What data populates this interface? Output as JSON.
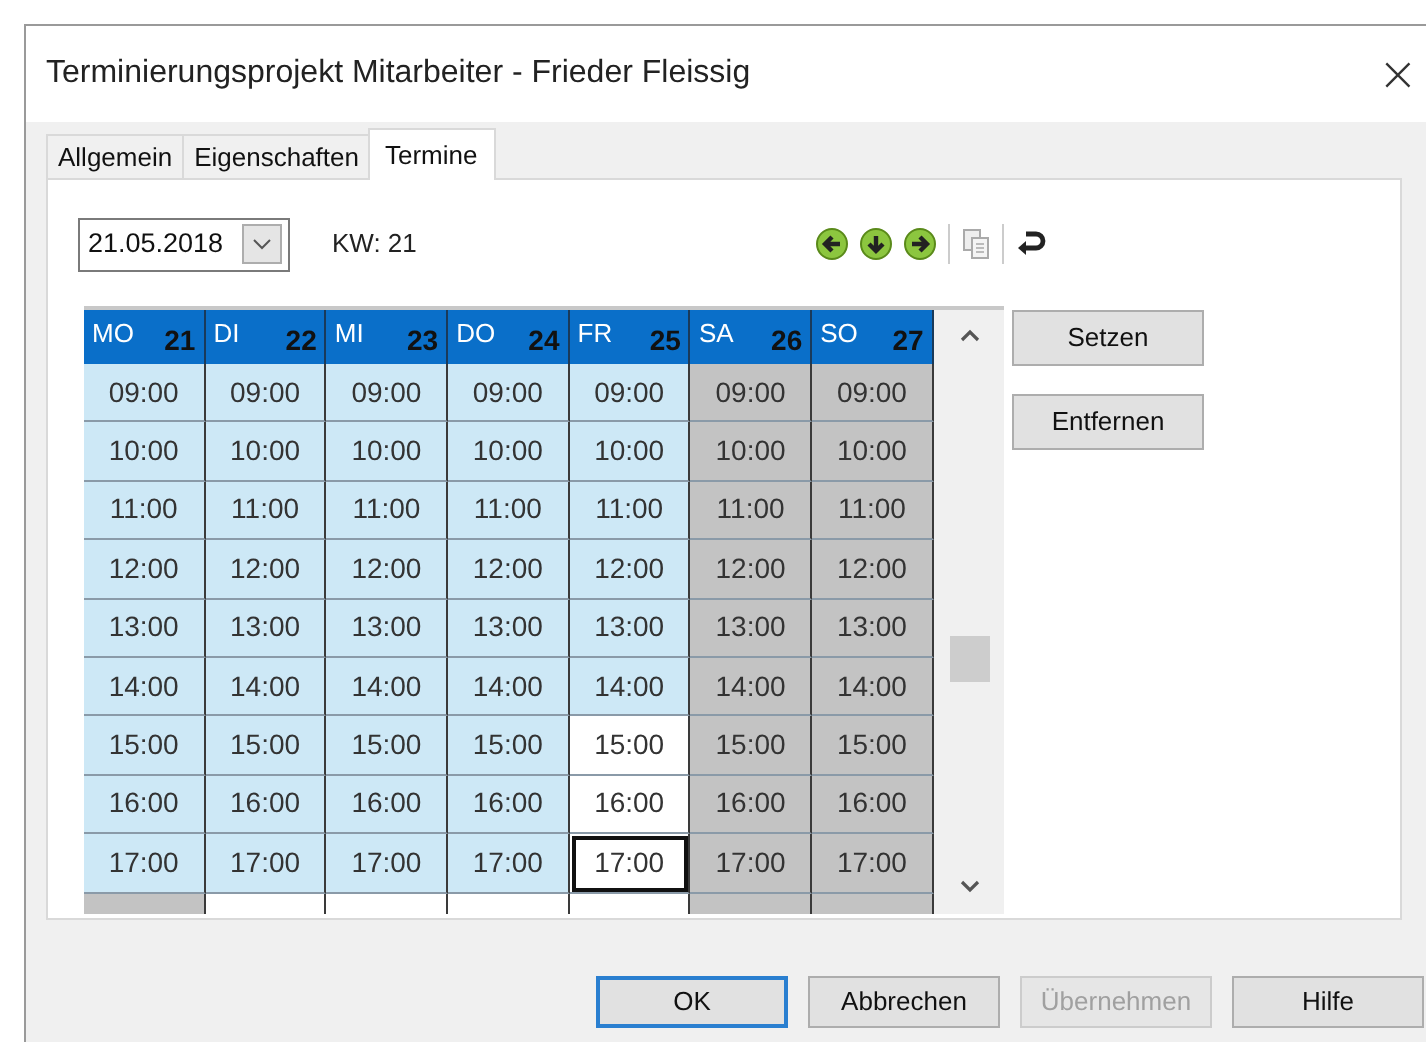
{
  "window": {
    "title": "Terminierungsprojekt Mitarbeiter - Frieder Fleissig",
    "close": "×"
  },
  "tabs": [
    {
      "label": "Allgemein",
      "selected": false
    },
    {
      "label": "Eigenschaften",
      "selected": false
    },
    {
      "label": "Termine",
      "selected": true
    }
  ],
  "date_field": {
    "value": "21.05.2018"
  },
  "week_label": "KW: 21",
  "calendar": {
    "days": [
      {
        "label": "MO",
        "number": "21"
      },
      {
        "label": "DI",
        "number": "22"
      },
      {
        "label": "MI",
        "number": "23"
      },
      {
        "label": "DO",
        "number": "24"
      },
      {
        "label": "FR",
        "number": "25"
      },
      {
        "label": "SA",
        "number": "26"
      },
      {
        "label": "SO",
        "number": "27"
      }
    ],
    "rows": [
      {
        "cells": [
          {
            "time": "09:00",
            "kind": "marked",
            "focused": false
          },
          {
            "time": "09:00",
            "kind": "marked",
            "focused": false
          },
          {
            "time": "09:00",
            "kind": "marked",
            "focused": false
          },
          {
            "time": "09:00",
            "kind": "marked",
            "focused": false
          },
          {
            "time": "09:00",
            "kind": "marked",
            "focused": false
          },
          {
            "time": "09:00",
            "kind": "weekend",
            "focused": false
          },
          {
            "time": "09:00",
            "kind": "weekend",
            "focused": false
          }
        ]
      },
      {
        "cells": [
          {
            "time": "10:00",
            "kind": "marked",
            "focused": false
          },
          {
            "time": "10:00",
            "kind": "marked",
            "focused": false
          },
          {
            "time": "10:00",
            "kind": "marked",
            "focused": false
          },
          {
            "time": "10:00",
            "kind": "marked",
            "focused": false
          },
          {
            "time": "10:00",
            "kind": "marked",
            "focused": false
          },
          {
            "time": "10:00",
            "kind": "weekend",
            "focused": false
          },
          {
            "time": "10:00",
            "kind": "weekend",
            "focused": false
          }
        ]
      },
      {
        "cells": [
          {
            "time": "11:00",
            "kind": "marked",
            "focused": false
          },
          {
            "time": "11:00",
            "kind": "marked",
            "focused": false
          },
          {
            "time": "11:00",
            "kind": "marked",
            "focused": false
          },
          {
            "time": "11:00",
            "kind": "marked",
            "focused": false
          },
          {
            "time": "11:00",
            "kind": "marked",
            "focused": false
          },
          {
            "time": "11:00",
            "kind": "weekend",
            "focused": false
          },
          {
            "time": "11:00",
            "kind": "weekend",
            "focused": false
          }
        ]
      },
      {
        "cells": [
          {
            "time": "12:00",
            "kind": "marked",
            "focused": false
          },
          {
            "time": "12:00",
            "kind": "marked",
            "focused": false
          },
          {
            "time": "12:00",
            "kind": "marked",
            "focused": false
          },
          {
            "time": "12:00",
            "kind": "marked",
            "focused": false
          },
          {
            "time": "12:00",
            "kind": "marked",
            "focused": false
          },
          {
            "time": "12:00",
            "kind": "weekend",
            "focused": false
          },
          {
            "time": "12:00",
            "kind": "weekend",
            "focused": false
          }
        ]
      },
      {
        "cells": [
          {
            "time": "13:00",
            "kind": "marked",
            "focused": false
          },
          {
            "time": "13:00",
            "kind": "marked",
            "focused": false
          },
          {
            "time": "13:00",
            "kind": "marked",
            "focused": false
          },
          {
            "time": "13:00",
            "kind": "marked",
            "focused": false
          },
          {
            "time": "13:00",
            "kind": "marked",
            "focused": false
          },
          {
            "time": "13:00",
            "kind": "weekend",
            "focused": false
          },
          {
            "time": "13:00",
            "kind": "weekend",
            "focused": false
          }
        ]
      },
      {
        "cells": [
          {
            "time": "14:00",
            "kind": "marked",
            "focused": false
          },
          {
            "time": "14:00",
            "kind": "marked",
            "focused": false
          },
          {
            "time": "14:00",
            "kind": "marked",
            "focused": false
          },
          {
            "time": "14:00",
            "kind": "marked",
            "focused": false
          },
          {
            "time": "14:00",
            "kind": "marked",
            "focused": false
          },
          {
            "time": "14:00",
            "kind": "weekend",
            "focused": false
          },
          {
            "time": "14:00",
            "kind": "weekend",
            "focused": false
          }
        ]
      },
      {
        "cells": [
          {
            "time": "15:00",
            "kind": "marked",
            "focused": false
          },
          {
            "time": "15:00",
            "kind": "marked",
            "focused": false
          },
          {
            "time": "15:00",
            "kind": "marked",
            "focused": false
          },
          {
            "time": "15:00",
            "kind": "marked",
            "focused": false
          },
          {
            "time": "15:00",
            "kind": "open",
            "focused": false
          },
          {
            "time": "15:00",
            "kind": "weekend",
            "focused": false
          },
          {
            "time": "15:00",
            "kind": "weekend",
            "focused": false
          }
        ]
      },
      {
        "cells": [
          {
            "time": "16:00",
            "kind": "marked",
            "focused": false
          },
          {
            "time": "16:00",
            "kind": "marked",
            "focused": false
          },
          {
            "time": "16:00",
            "kind": "marked",
            "focused": false
          },
          {
            "time": "16:00",
            "kind": "marked",
            "focused": false
          },
          {
            "time": "16:00",
            "kind": "open",
            "focused": false
          },
          {
            "time": "16:00",
            "kind": "weekend",
            "focused": false
          },
          {
            "time": "16:00",
            "kind": "weekend",
            "focused": false
          }
        ]
      },
      {
        "cells": [
          {
            "time": "17:00",
            "kind": "marked",
            "focused": false
          },
          {
            "time": "17:00",
            "kind": "marked",
            "focused": false
          },
          {
            "time": "17:00",
            "kind": "marked",
            "focused": false
          },
          {
            "time": "17:00",
            "kind": "marked",
            "focused": false
          },
          {
            "time": "17:00",
            "kind": "open",
            "focused": true
          },
          {
            "time": "17:00",
            "kind": "weekend",
            "focused": false
          },
          {
            "time": "17:00",
            "kind": "weekend",
            "focused": false
          }
        ]
      },
      {
        "cells": [
          {
            "kind": "weekend",
            "focused": false
          },
          {
            "kind": "open",
            "focused": false
          },
          {
            "kind": "open",
            "focused": false
          },
          {
            "kind": "open",
            "focused": false
          },
          {
            "kind": "open",
            "focused": false
          },
          {
            "kind": "weekend",
            "focused": false
          },
          {
            "kind": "weekend",
            "focused": false
          }
        ]
      }
    ]
  },
  "side_buttons": [
    {
      "label": "Setzen"
    },
    {
      "label": "Entfernen"
    }
  ],
  "footer_buttons": [
    {
      "label": "OK",
      "default": true,
      "disabled": false
    },
    {
      "label": "Abbrechen",
      "default": false,
      "disabled": false
    },
    {
      "label": "Übernehmen",
      "default": false,
      "disabled": true
    },
    {
      "label": "Hilfe",
      "default": false,
      "disabled": false
    }
  ]
}
